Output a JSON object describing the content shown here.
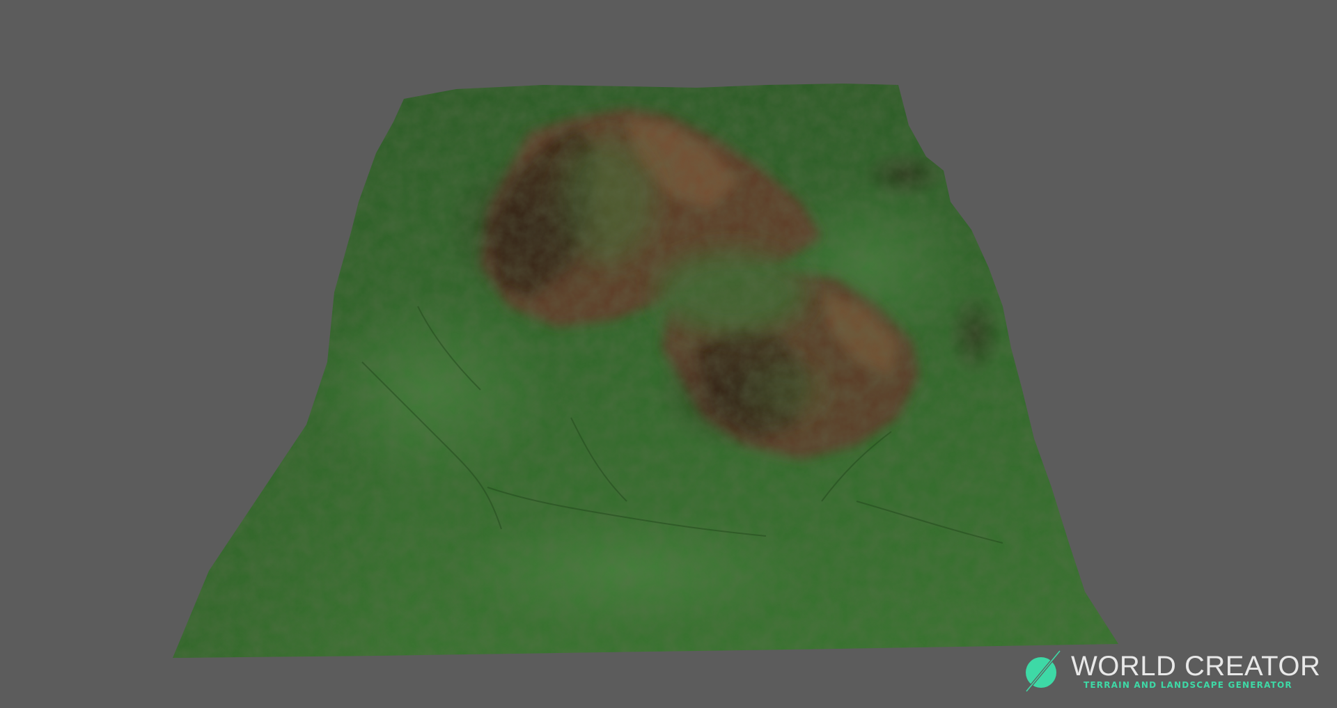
{
  "scene": {
    "background_color": "#5c5c5c",
    "terrain_color": "#356b2c",
    "terrain_dark_color": "#264f20",
    "rock_color": "#6b4a31",
    "rock_dark_color": "#3d2a1c"
  },
  "watermark": {
    "icon": "world-creator-logo-icon",
    "title": "WORLD CREATOR",
    "subtitle": "TERRAIN AND LANDSCAPE GENERATOR",
    "accent_color": "#3ed9a6"
  }
}
